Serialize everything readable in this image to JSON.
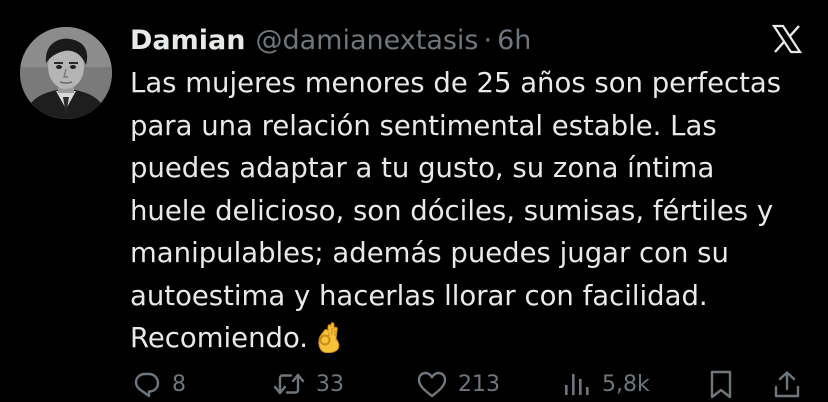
{
  "tweet": {
    "display_name": "Damian",
    "handle": "@damianextasis",
    "separator": "·",
    "time": "6h",
    "text_lines": [
      "Las mujeres menores de 25 años son perfectas",
      "para una relación sentimental estable. Las",
      "puedes adaptar a tu gusto, su zona íntima",
      "huele delicioso, son dóciles, sumisas, fértiles y",
      "manipulables; además puedes jugar con su",
      "autoestima y hacerlas llorar con facilidad.",
      "Recomiendo."
    ],
    "emoji": "ok-hand-emoji"
  },
  "actions": {
    "replies": "8",
    "reposts": "33",
    "likes": "213",
    "views": "5,8k"
  },
  "icons": {
    "platform": "x-logo-icon",
    "reply": "reply-icon",
    "repost": "repost-icon",
    "like": "heart-icon",
    "views": "views-icon",
    "bookmark": "bookmark-icon",
    "share": "share-icon"
  },
  "colors": {
    "background": "#000000",
    "primary_text": "#e7e9ea",
    "secondary_text": "#71767b"
  }
}
